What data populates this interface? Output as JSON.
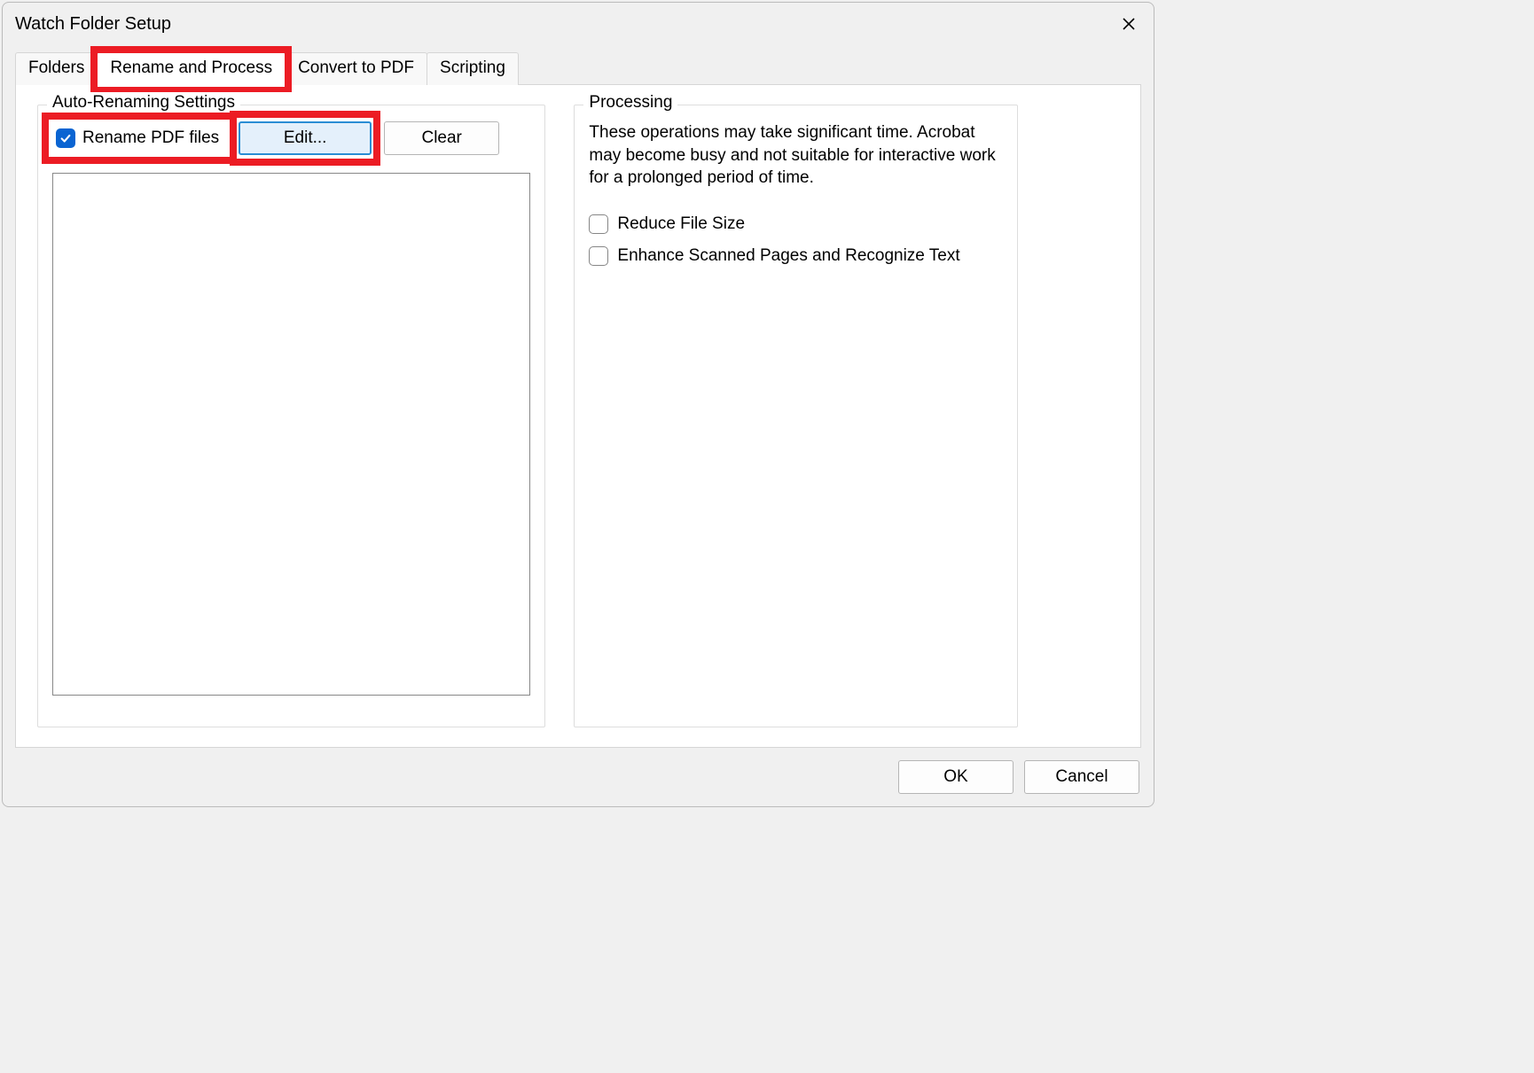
{
  "dialog": {
    "title": "Watch Folder Setup"
  },
  "tabs": {
    "folders": "Folders",
    "rename": "Rename and Process",
    "convert": "Convert to PDF",
    "scripting": "Scripting",
    "active": "rename"
  },
  "rename_panel": {
    "legend": "Auto-Renaming Settings",
    "checkbox_label": "Rename PDF files",
    "checkbox_checked": true,
    "edit_btn": "Edit...",
    "clear_btn": "Clear"
  },
  "processing_panel": {
    "legend": "Processing",
    "note": "These operations may take significant time. Acrobat may become busy and not suitable for interactive work for a prolonged period of time.",
    "opt_reduce": {
      "label": "Reduce File Size",
      "checked": false
    },
    "opt_enhance": {
      "label": "Enhance Scanned Pages and Recognize Text",
      "checked": false
    }
  },
  "footer": {
    "ok": "OK",
    "cancel": "Cancel"
  },
  "annotations": {
    "highlight_color": "#ec1c24"
  }
}
